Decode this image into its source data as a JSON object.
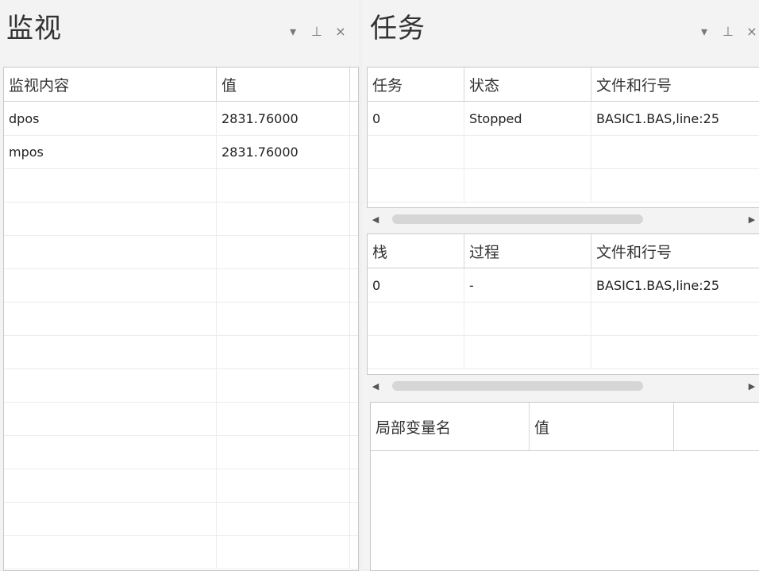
{
  "watch": {
    "title": "监视",
    "columns": [
      "监视内容",
      "值"
    ],
    "rows": [
      {
        "name": "dpos",
        "value": "2831.76000"
      },
      {
        "name": "mpos",
        "value": "2831.76000"
      }
    ]
  },
  "task": {
    "title": "任务",
    "tasks": {
      "columns": [
        "任务",
        "状态",
        "文件和行号"
      ],
      "rows": [
        {
          "task": "0",
          "status": "Stopped",
          "file_line": "BASIC1.BAS,line:25"
        }
      ]
    },
    "stack": {
      "columns": [
        "栈",
        "过程",
        "文件和行号"
      ],
      "rows": [
        {
          "stack": "0",
          "proc": "-",
          "file_line": "BASIC1.BAS,line:25"
        }
      ]
    },
    "locals": {
      "columns": [
        "局部变量名",
        "值"
      ]
    }
  },
  "icons": {
    "dropdown": "▾",
    "pin": "⊥",
    "close": "×",
    "scroll_left": "◀",
    "scroll_right": "▶"
  }
}
